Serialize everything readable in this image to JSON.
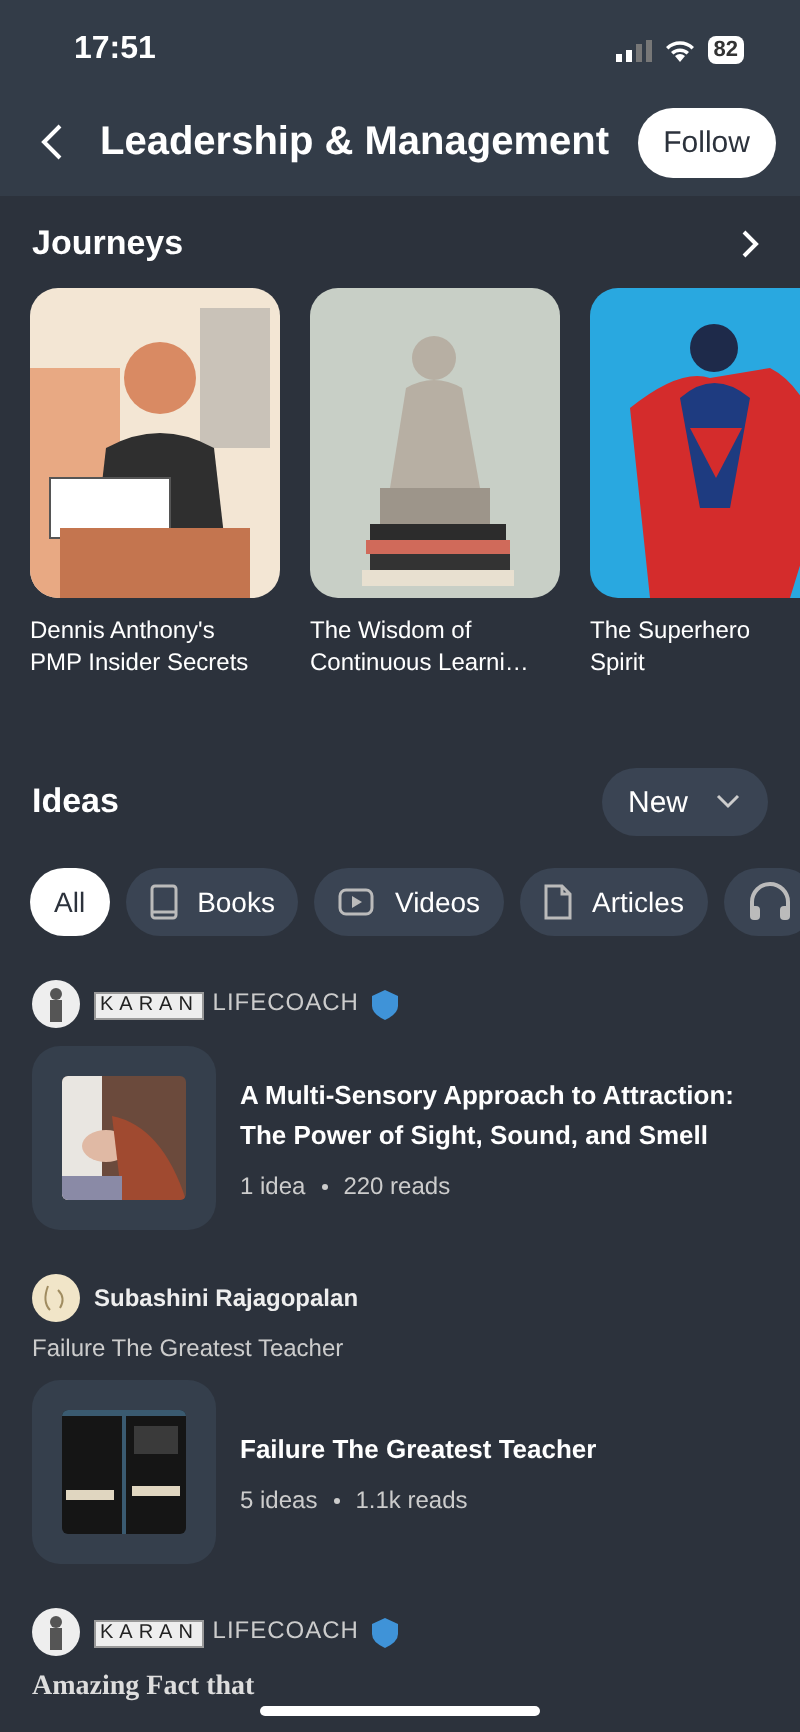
{
  "status_bar": {
    "time": "17:51",
    "battery": "82"
  },
  "header": {
    "title": "Leadership & Management",
    "follow_button": "Follow"
  },
  "journeys": {
    "title": "Journeys",
    "items": [
      {
        "title": "Dennis Anthony's PMP Insider Secrets"
      },
      {
        "title": "The Wisdom of Continuous Learni…"
      },
      {
        "title": "The Superhero Spirit"
      }
    ]
  },
  "ideas": {
    "title": "Ideas",
    "sort": "New",
    "filters": [
      {
        "label": "All",
        "selected": true
      },
      {
        "label": "Books",
        "selected": false
      },
      {
        "label": "Videos",
        "selected": false
      },
      {
        "label": "Articles",
        "selected": false
      },
      {
        "selected": false
      }
    ]
  },
  "posts": [
    {
      "author": "KARAN LIFECOACH",
      "verified": true,
      "card": {
        "title": "A Multi-Sensory Approach to Attraction: The Power of Sight, Sound, and Smell",
        "ideas": "1 idea",
        "reads": "220 reads"
      }
    },
    {
      "author": "Subashini Rajagopalan",
      "verified": false,
      "subtitle": "Failure The Greatest Teacher",
      "card": {
        "title": "Failure The Greatest Teacher",
        "ideas": "5 ideas",
        "reads": "1.1k reads"
      }
    },
    {
      "author": "KARAN LIFECOACH",
      "verified": true,
      "teaser": "Amazing Fact that"
    }
  ]
}
